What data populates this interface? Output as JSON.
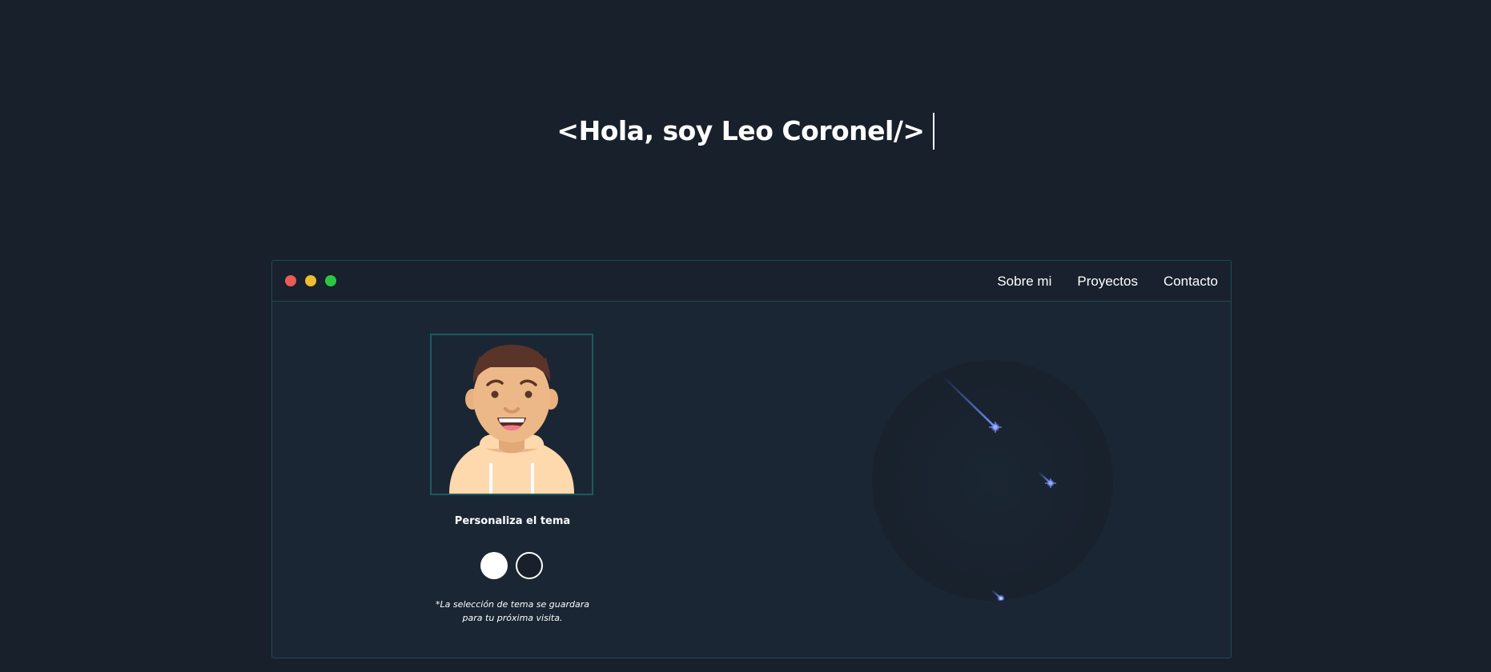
{
  "hero": {
    "title": "<Hola, soy Leo Coronel/>"
  },
  "window": {
    "controls": [
      "close",
      "minimize",
      "maximize"
    ],
    "nav": [
      {
        "label": "Sobre mi"
      },
      {
        "label": "Proyectos"
      },
      {
        "label": "Contacto"
      }
    ]
  },
  "profile": {
    "avatar": "cartoon-avatar",
    "theme_label": "Personaliza el tema",
    "theme_note_line1": "*La selección de tema se guardara",
    "theme_note_line2": "para tu próxima visita.",
    "theme_options": [
      "light",
      "dark"
    ]
  },
  "colors": {
    "background": "#17202b",
    "window": "#1a2633",
    "border": "#1f4a55",
    "dot_red": "#ec5b53",
    "dot_yellow": "#f2bc2f",
    "dot_green": "#2ac840",
    "star": "#5a7cff"
  }
}
